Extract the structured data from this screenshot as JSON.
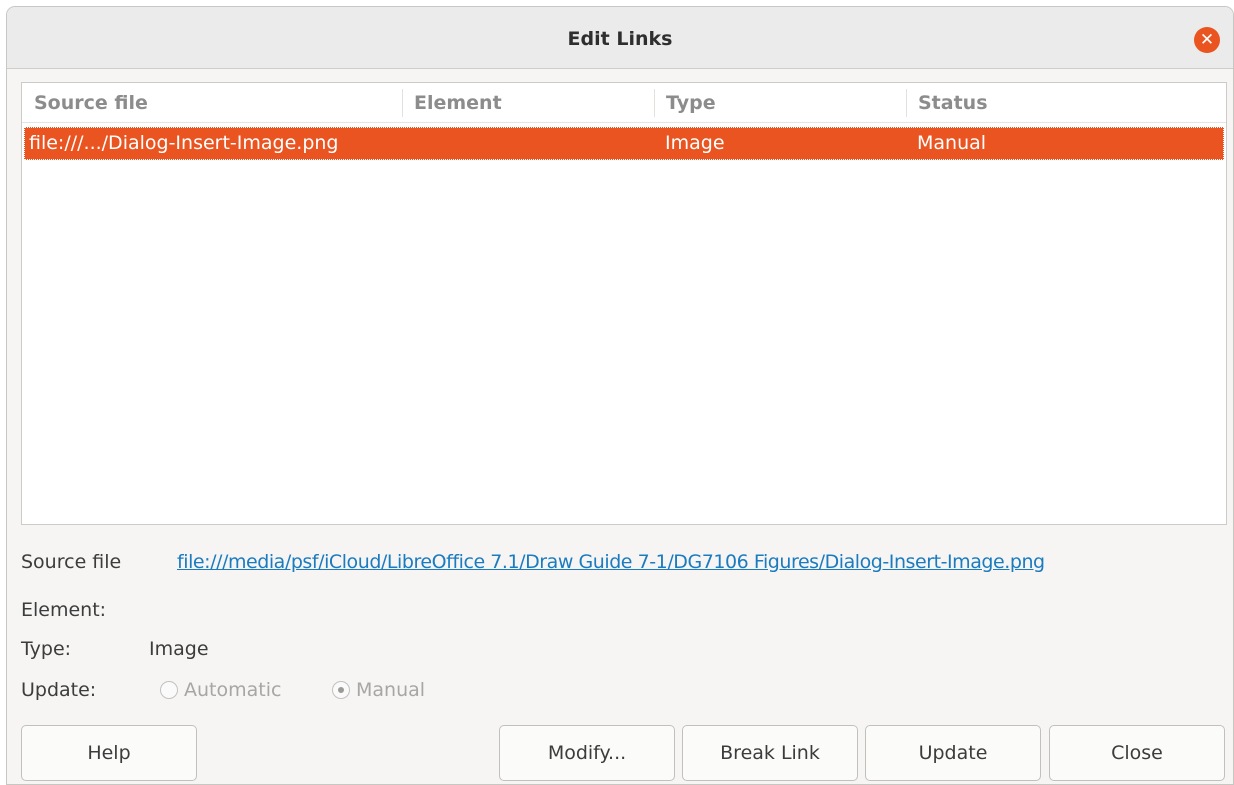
{
  "dialog": {
    "title": "Edit Links"
  },
  "table": {
    "columns": [
      "Source file",
      "Element",
      "Type",
      "Status"
    ],
    "rows": [
      {
        "source_file": "file:///.../Dialog-Insert-Image.png",
        "element": "",
        "type": "Image",
        "status": "Manual",
        "selected": true
      }
    ]
  },
  "details": {
    "source_file_label": "Source file",
    "source_file_value": "file:///media/psf/iCloud/LibreOffice 7.1/Draw Guide 7-1/DG7106 Figures/Dialog-Insert-Image.png",
    "element_label": "Element:",
    "element_value": "",
    "type_label": "Type:",
    "type_value": "Image",
    "update_label": "Update:",
    "update_options": [
      {
        "label": "Automatic",
        "checked": false,
        "enabled": false
      },
      {
        "label": "Manual",
        "checked": true,
        "enabled": false
      }
    ]
  },
  "buttons": {
    "help": "Help",
    "modify": "Modify...",
    "break_link": "Break Link",
    "update": "Update",
    "close": "Close"
  },
  "icons": {
    "close_icon": "close-icon"
  },
  "colors": {
    "accent": "#e95420",
    "link": "#1b7bbf"
  }
}
